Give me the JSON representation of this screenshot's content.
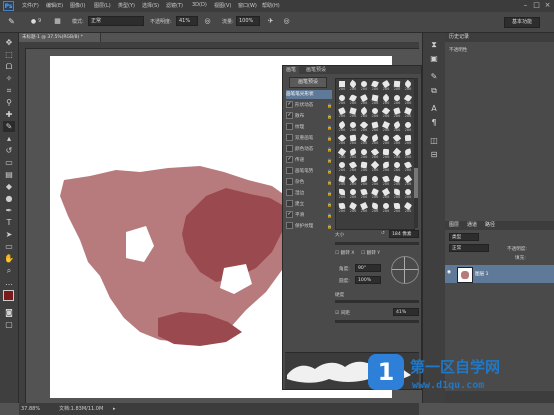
{
  "app": {
    "logo": "Ps",
    "menus": [
      "文件(F)",
      "编辑(E)",
      "图像(I)",
      "图层(L)",
      "类型(Y)",
      "选择(S)",
      "滤镜(T)",
      "3D(D)",
      "视图(V)",
      "窗口(W)",
      "帮助(H)"
    ],
    "window_controls": [
      "minimize-icon",
      "maximize-icon",
      "close-icon"
    ]
  },
  "options": {
    "brush_size": "9",
    "mode_label": "模式:",
    "mode_value": "正常",
    "opacity_label": "不透明度:",
    "opacity_value": "41%",
    "flow_label": "流量:",
    "flow_value": "100%",
    "workspace": "基本功能"
  },
  "document": {
    "tab_title": "未标题-1 @ 37.5%(RGB/8) *",
    "zoom": "37.88%",
    "doc_info": "文档:1.83M/11.0M"
  },
  "colors": {
    "foreground": "#7a1b1b",
    "background": "#ffffff",
    "paint_light": "#b87b7d",
    "paint_dark": "#9a4a4e",
    "accent": "#5f7a99"
  },
  "brush_panel": {
    "tabs": [
      "画笔",
      "画笔预设"
    ],
    "presets_button": "画笔预设",
    "options": [
      {
        "label": "画笔笔尖形状",
        "checked": false,
        "selected": true
      },
      {
        "label": "形状动态",
        "checked": true
      },
      {
        "label": "散布",
        "checked": true
      },
      {
        "label": "纹理",
        "checked": false
      },
      {
        "label": "双重画笔",
        "checked": false
      },
      {
        "label": "颜色动态",
        "checked": false
      },
      {
        "label": "传递",
        "checked": true
      },
      {
        "label": "画笔笔势",
        "checked": false
      },
      {
        "label": "杂色",
        "checked": false
      },
      {
        "label": "湿边",
        "checked": false
      },
      {
        "label": "建立",
        "checked": false
      },
      {
        "label": "平滑",
        "checked": true
      },
      {
        "label": "保护纹理",
        "checked": false
      }
    ],
    "tip_numbers": [
      "286",
      "286",
      "286",
      "286",
      "286",
      "286",
      "286",
      "286",
      "286",
      "286",
      "286",
      "286",
      "286",
      "286",
      "286",
      "286",
      "286",
      "286",
      "286",
      "286",
      "286",
      "286",
      "286",
      "286",
      "286",
      "286",
      "286",
      "286",
      "286",
      "286",
      "286",
      "286",
      "286",
      "286",
      "286",
      "286",
      "286",
      "286",
      "286",
      "286",
      "286",
      "286",
      "286",
      "286",
      "286",
      "286",
      "286",
      "286",
      "286",
      "286",
      "286",
      "286",
      "286",
      "286",
      "286",
      "286",
      "286",
      "286",
      "286",
      "286",
      "286",
      "286",
      "286",
      "286",
      "286",
      "286",
      "286",
      "286",
      "286",
      "286"
    ],
    "size_label": "大小",
    "size_value": "184 像素",
    "flip_x": "翻转 X",
    "flip_y": "翻转 Y",
    "angle_label": "角度:",
    "angle_value": "90°",
    "roundness_label": "圆度:",
    "roundness_value": "100%",
    "hardness_label": "硬度",
    "spacing_label": "间距",
    "spacing_value": "41%"
  },
  "history_panel": {
    "tabs": [
      "历史记录"
    ],
    "item": "不透明性"
  },
  "layers_panel": {
    "tabs": [
      "图层",
      "通道",
      "路径"
    ],
    "kind_label": "类型",
    "blend": "正常",
    "opacity_label": "不透明度:",
    "fill_label": "填充:",
    "layer_name": "图层 1"
  },
  "watermark": {
    "brand": "第一区自学网",
    "url": "www.d1qu.com",
    "glyph": "1"
  }
}
